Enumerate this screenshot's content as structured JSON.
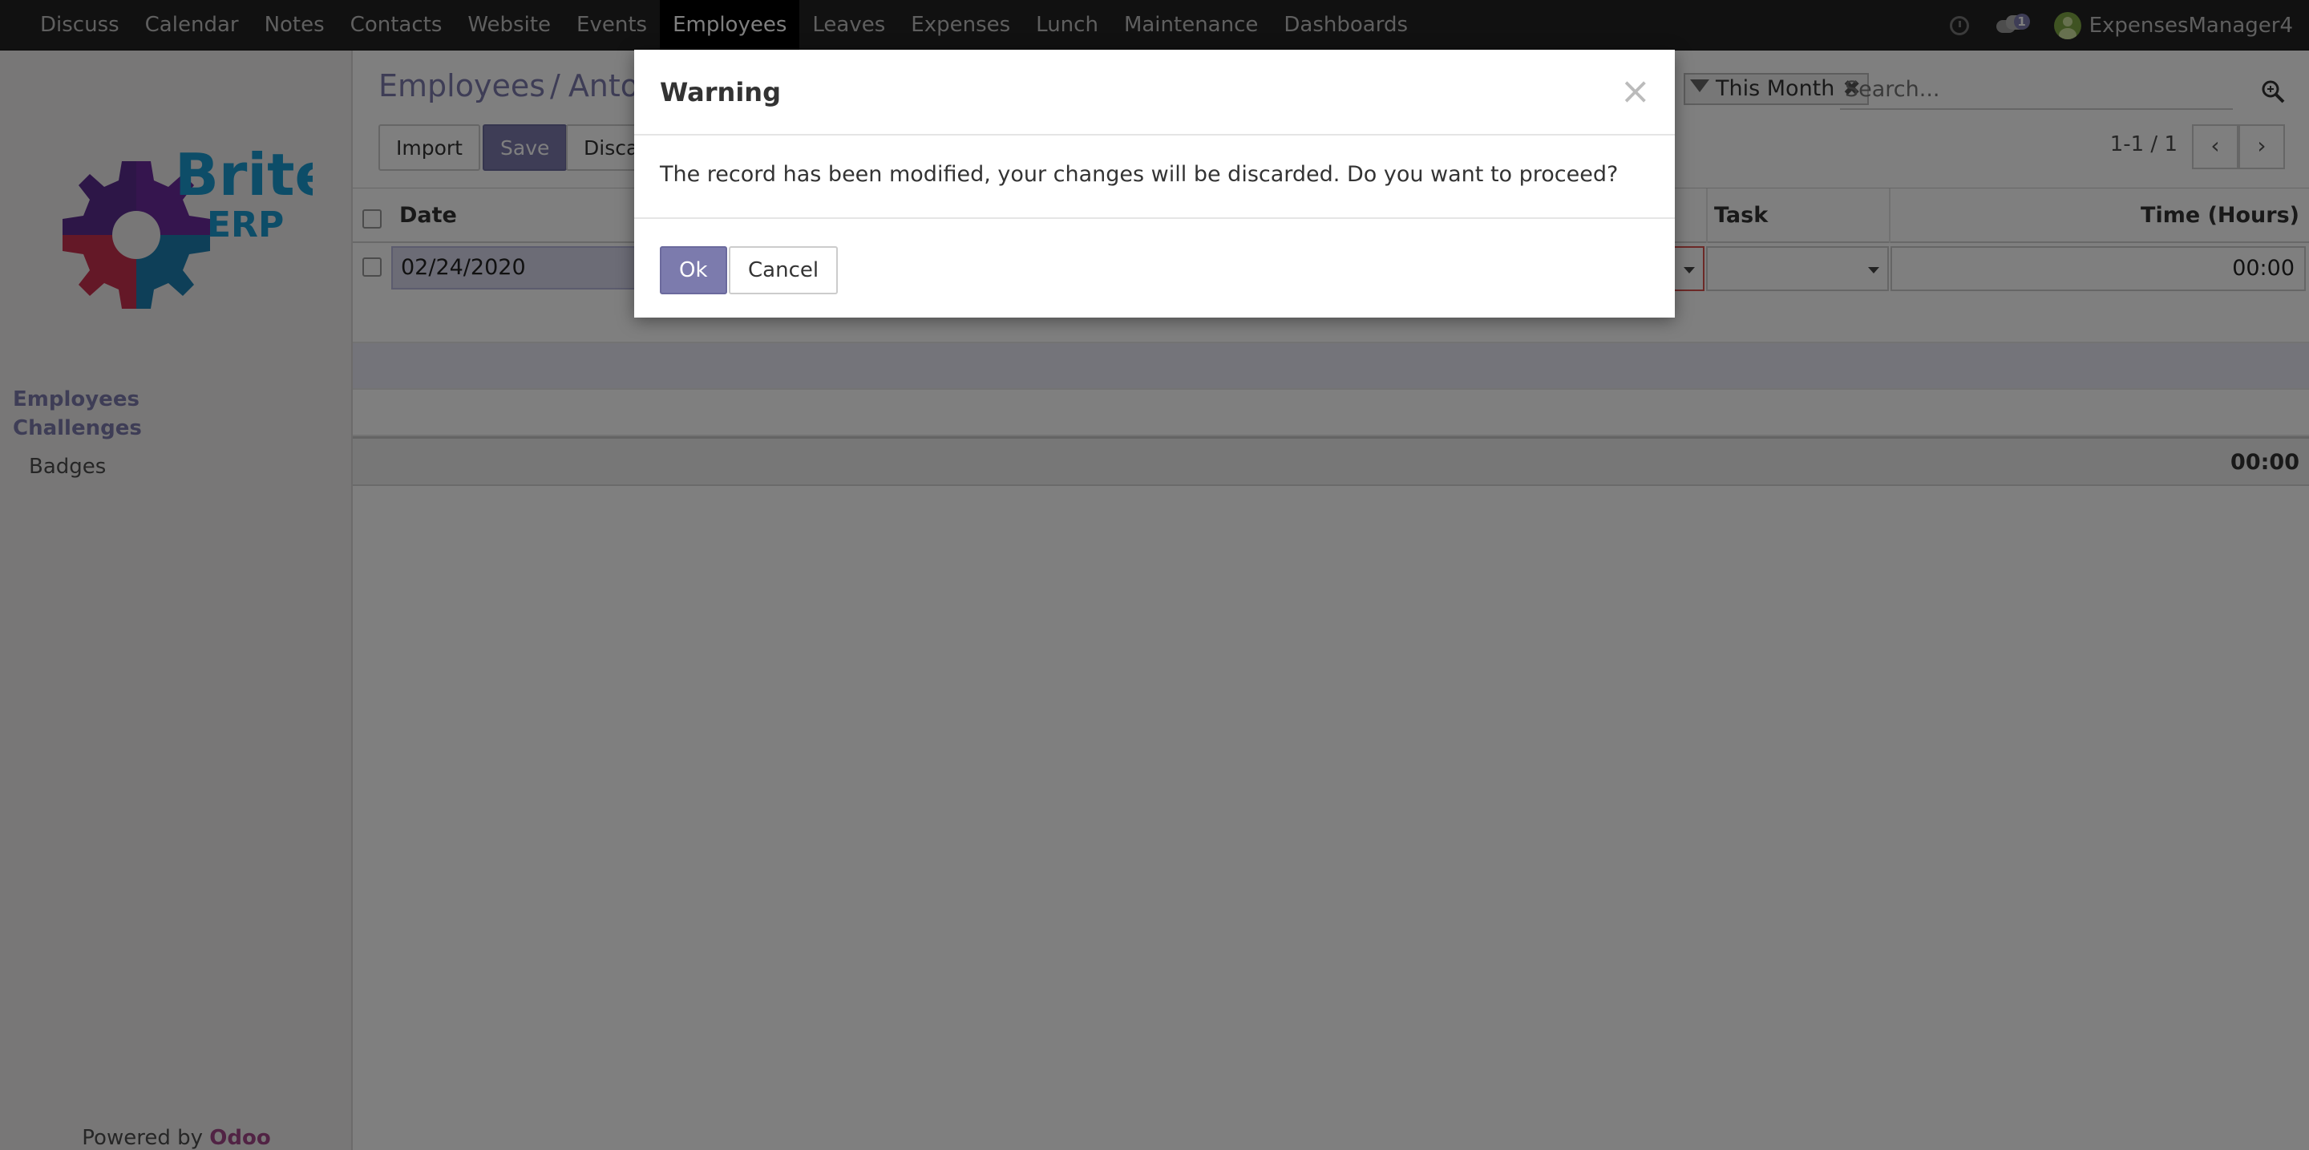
{
  "topnav": {
    "items": [
      "Discuss",
      "Calendar",
      "Notes",
      "Contacts",
      "Website",
      "Events",
      "Employees",
      "Leaves",
      "Expenses",
      "Lunch",
      "Maintenance",
      "Dashboards"
    ],
    "active_index": 6,
    "chat_count": "1",
    "username": "ExpensesManager4"
  },
  "sidebar": {
    "logo": {
      "line1": "Brite",
      "line2": "ERP"
    },
    "heading1": "Employees",
    "heading2": "Challenges",
    "item1": "Badges",
    "powered_by": "Powered by ",
    "powered_brand": "Odoo"
  },
  "control": {
    "breadcrumb_root": "Employees",
    "breadcrumb_sep": "/",
    "breadcrumb_current": "Anto",
    "import_label": "Import",
    "save_label": "Save",
    "discard_label": "Disca",
    "facet_label": "This Month",
    "search_placeholder": "Search...",
    "pager_value": "1-1 / 1"
  },
  "table": {
    "headers": {
      "date": "Date",
      "task": "Task",
      "time": "Time (Hours)"
    },
    "edit_row": {
      "date": "02/24/2020",
      "time": "00:00"
    },
    "total": "00:00"
  },
  "modal": {
    "title": "Warning",
    "close_symbol": "×",
    "message": "The record has been modified, your changes will be discarded. Do you want to proceed?",
    "ok_label": "Ok",
    "cancel_label": "Cancel"
  },
  "colors": {
    "brand": "#7c7bad",
    "navbar": "#222222",
    "odoo": "#a24689"
  }
}
